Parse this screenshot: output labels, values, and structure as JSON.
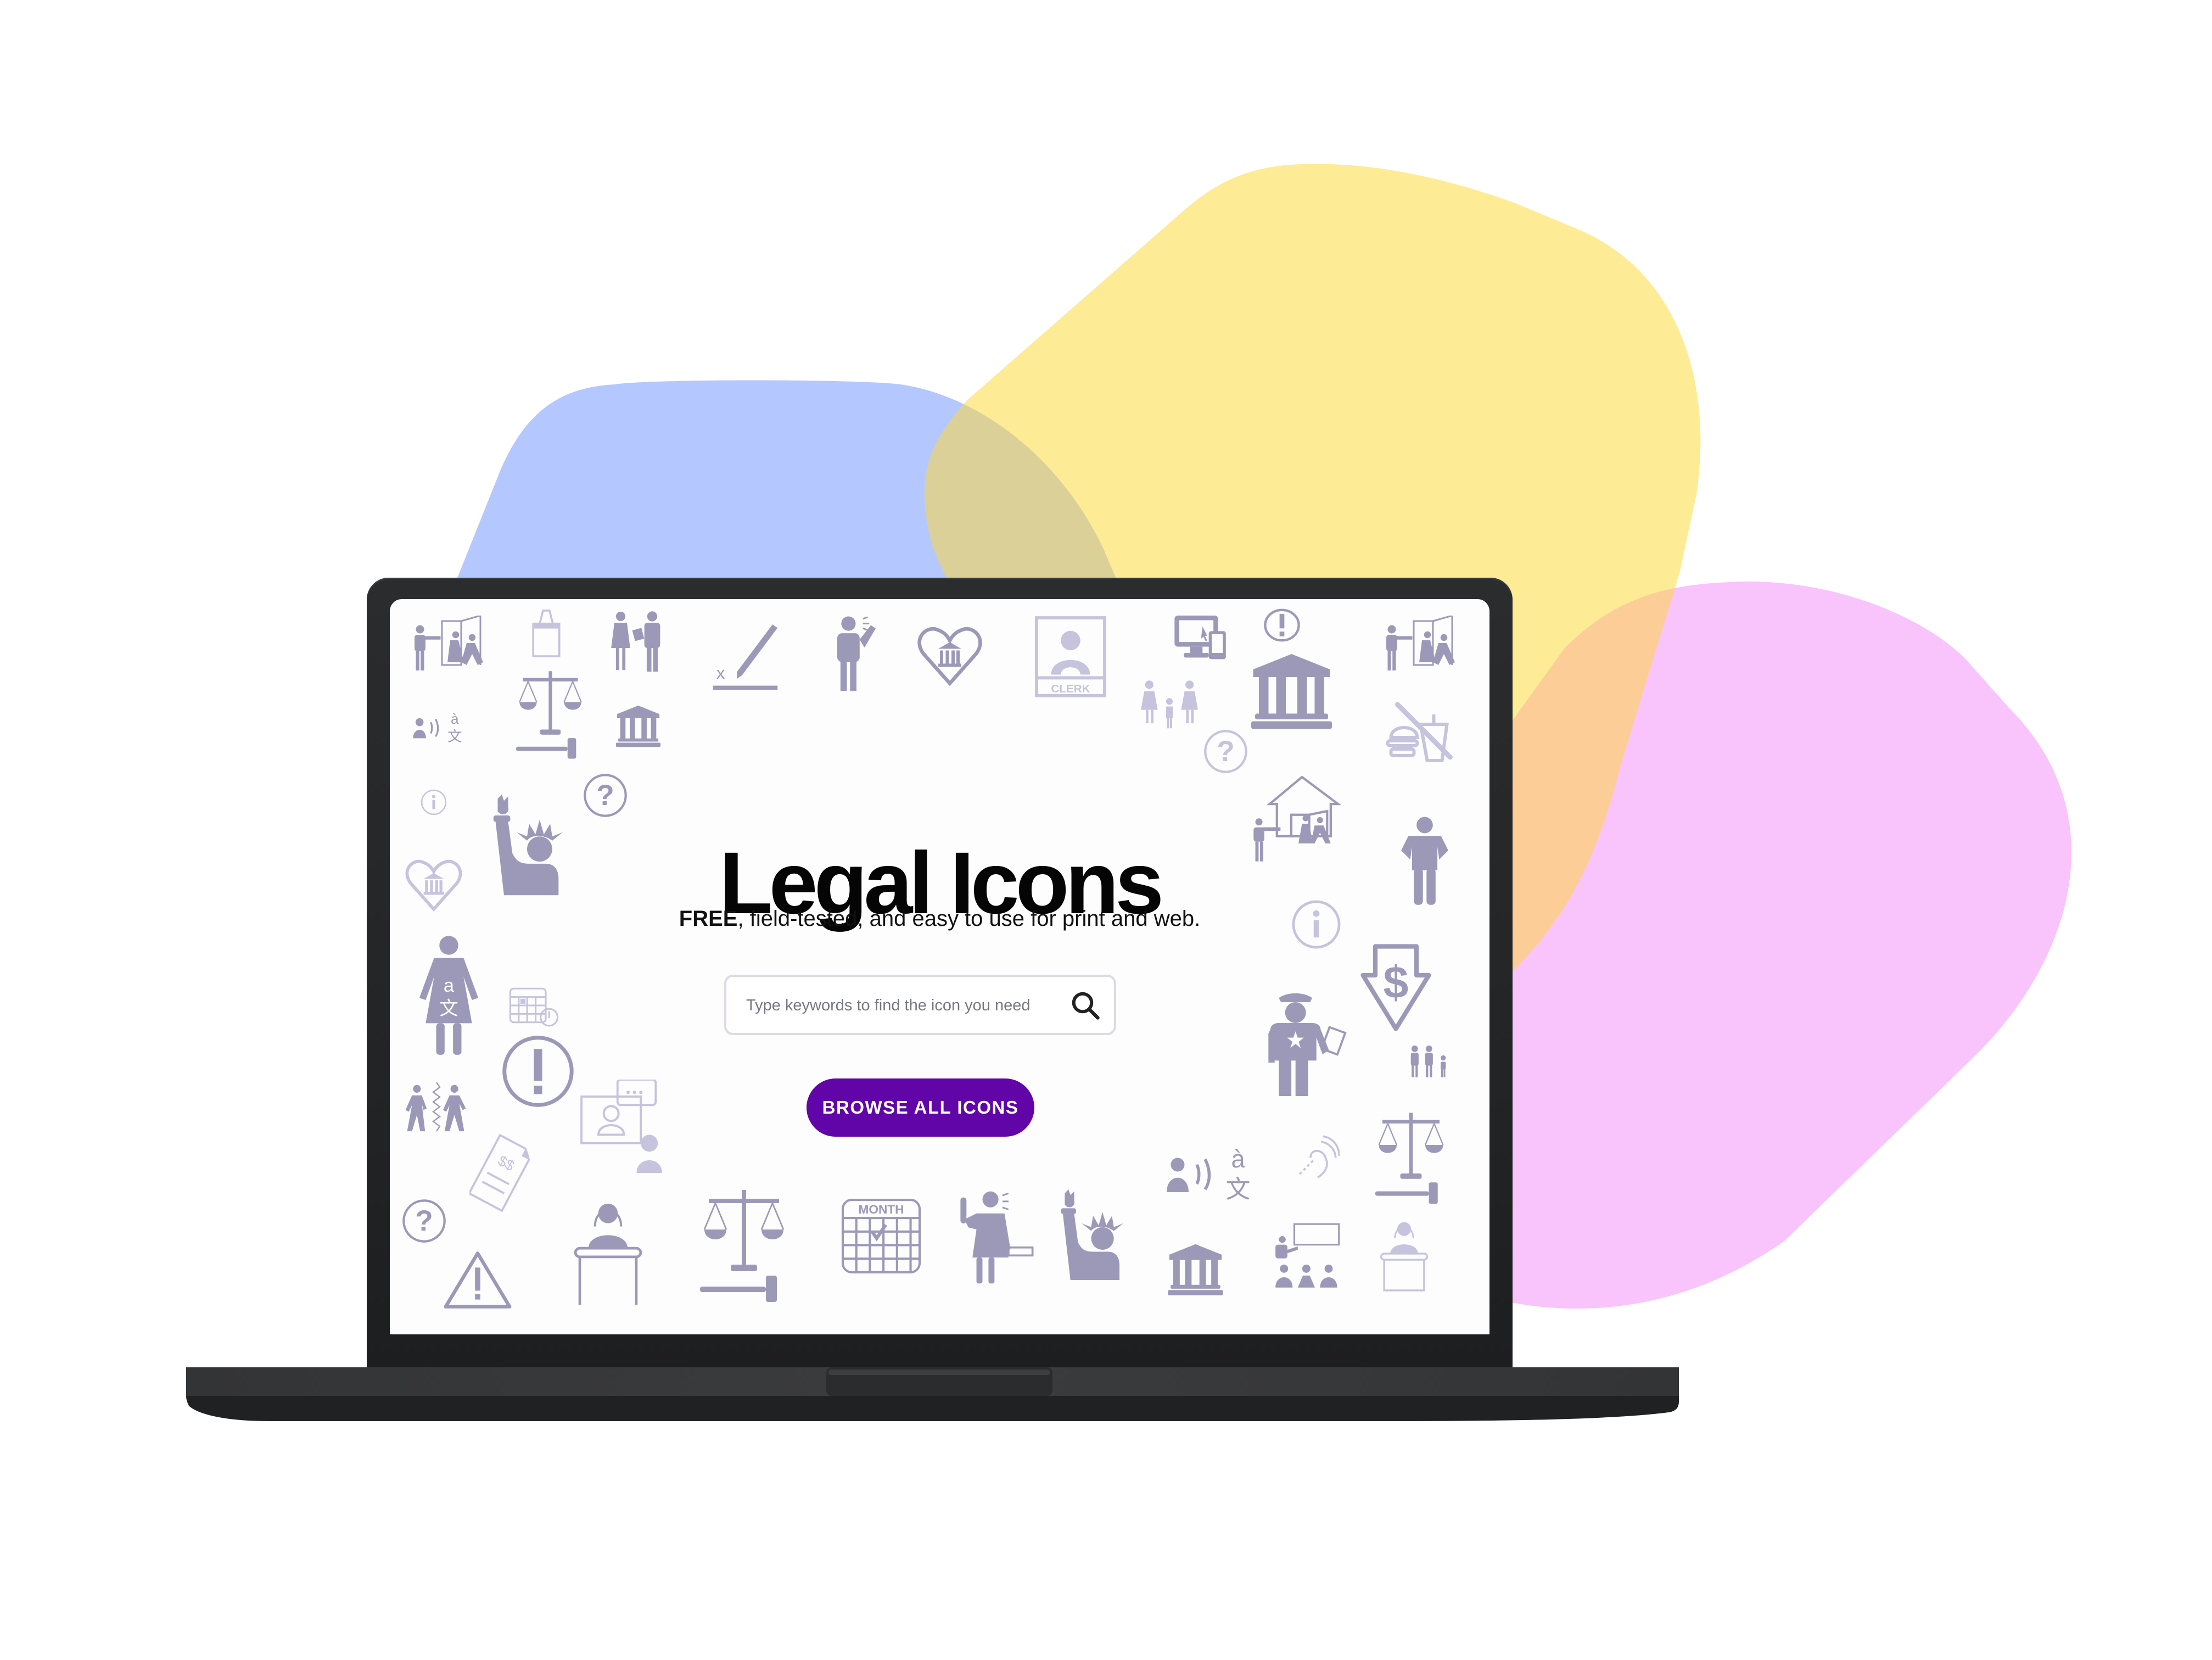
{
  "background": {
    "blob_colors": {
      "blue": "#b4c7fe",
      "yellow": "#feeb96",
      "pink": "#f9c3fc",
      "blue_yellow_overlap": "#dad098",
      "yellow_pink_overlap": "#fdcd98"
    }
  },
  "device": "laptop",
  "page": {
    "title": "Legal Icons",
    "subtitle_bold": "FREE",
    "subtitle_rest": ", field-tested, and easy to use for print and web.",
    "search": {
      "placeholder": "Type keywords to find the icon you need",
      "value": "",
      "icon": "search-icon"
    },
    "browse_button": {
      "label": "BROWSE ALL ICONS",
      "color": "#6105a8"
    },
    "icon_color": "#9c99b8",
    "icon_labels": {
      "clerk": "CLERK",
      "calendar_month": "MONTH",
      "bill": "$$",
      "dollar": "$",
      "translate_a": "a",
      "translate_x": "文",
      "translate_accent": "à"
    },
    "decorative_icons": [
      "eviction-icon",
      "ballot-box-icon",
      "couple-with-document-icon",
      "sign-here-icon",
      "person-speaking-icon",
      "heart-courthouse-icon",
      "clerk-icon",
      "computer-devices-icon",
      "alert-circle-icon",
      "courthouse-icon",
      "eviction-icon",
      "scales-gavel-icon",
      "interpreter-icon",
      "courthouse-icon",
      "family-icon",
      "question-circle-icon",
      "no-food-drink-icon",
      "info-circle-icon",
      "question-circle-icon",
      "liberty-statue-icon",
      "heart-courthouse-icon",
      "home-eviction-icon",
      "person-standing-icon",
      "info-circle-icon",
      "woman-interpreter-icon",
      "calendar-alert-icon",
      "dollar-down-icon",
      "alert-circle-icon",
      "police-officer-icon",
      "family-icon",
      "separation-icon",
      "video-call-icon",
      "bill-icon",
      "interpreter-icon",
      "hearing-assist-icon",
      "scales-gavel-icon",
      "question-circle-icon",
      "judge-icon",
      "scales-gavel-icon",
      "calendar-month-icon",
      "woman-oath-icon",
      "liberty-statue-icon",
      "courthouse-icon",
      "classroom-icon",
      "judge-icon",
      "warning-triangle-icon"
    ]
  }
}
